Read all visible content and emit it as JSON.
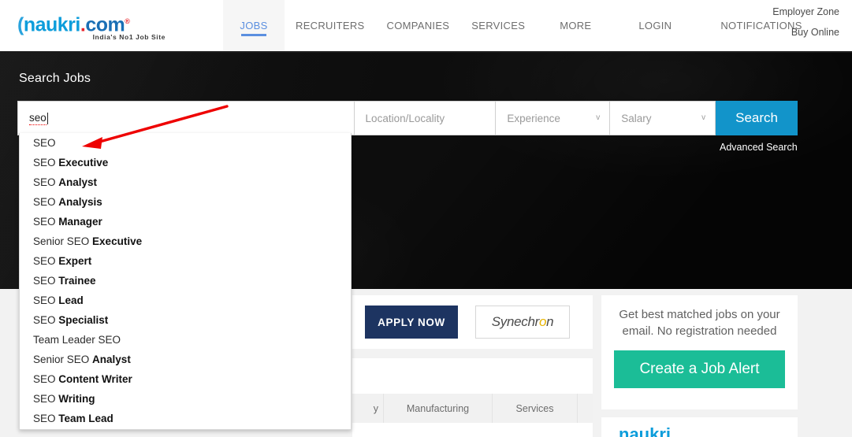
{
  "header": {
    "logo": {
      "c": "(",
      "name": "naukri",
      "dot": ".",
      "com": "com",
      "reg": "®",
      "tagline": "India's No1 Job Site"
    },
    "nav": [
      {
        "label": "JOBS",
        "active": true
      },
      {
        "label": "RECRUITERS",
        "active": false
      },
      {
        "label": "COMPANIES",
        "active": false
      },
      {
        "label": "SERVICES",
        "active": false
      },
      {
        "label": "MORE",
        "active": false
      },
      {
        "label": "LOGIN",
        "active": false
      },
      {
        "label": "NOTIFICATIONS",
        "active": false
      }
    ],
    "corner_links": [
      "Employer Zone",
      "Buy Online"
    ]
  },
  "hero": {
    "title": "Search Jobs",
    "background_color": "#050505"
  },
  "search": {
    "keyword_value": "seo",
    "location_placeholder": "Location/Locality",
    "experience_placeholder": "Experience",
    "salary_placeholder": "Salary",
    "button_label": "Search",
    "advanced_label": "Advanced Search",
    "button_color": "#1294ca",
    "chevron_icon": "v"
  },
  "suggestions": [
    {
      "plain": "SEO",
      "bold": ""
    },
    {
      "plain": "SEO ",
      "bold": "Executive"
    },
    {
      "plain": "SEO ",
      "bold": "Analyst"
    },
    {
      "plain": "SEO ",
      "bold": "Analysis"
    },
    {
      "plain": "SEO ",
      "bold": "Manager"
    },
    {
      "plain": "Senior SEO ",
      "bold": "Executive"
    },
    {
      "plain": "SEO ",
      "bold": "Expert"
    },
    {
      "plain": "SEO ",
      "bold": "Trainee"
    },
    {
      "plain": "SEO ",
      "bold": "Lead"
    },
    {
      "plain": "SEO ",
      "bold": "Specialist"
    },
    {
      "plain": "Team Leader SEO",
      "bold": ""
    },
    {
      "plain": "Senior SEO ",
      "bold": "Analyst"
    },
    {
      "plain": "SEO ",
      "bold": "Content Writer"
    },
    {
      "plain": "SEO ",
      "bold": "Writing"
    },
    {
      "plain": "SEO ",
      "bold": "Team Lead"
    }
  ],
  "annotation": {
    "arrow_color": "#ee0000"
  },
  "job_card": {
    "apply_label": "APPLY NOW",
    "apply_color": "#1d3461",
    "company_name_a": "Synechr",
    "company_name_hl": "o",
    "company_name_b": "n"
  },
  "industry_tabs": [
    "y",
    "Manufacturing",
    "Services",
    ""
  ],
  "job_alert": {
    "text": "Get best matched jobs on your email. No registration needed",
    "button_label": "Create a Job Alert",
    "button_color": "#1bbd97"
  },
  "footer_logo": {
    "text": "naukri"
  }
}
